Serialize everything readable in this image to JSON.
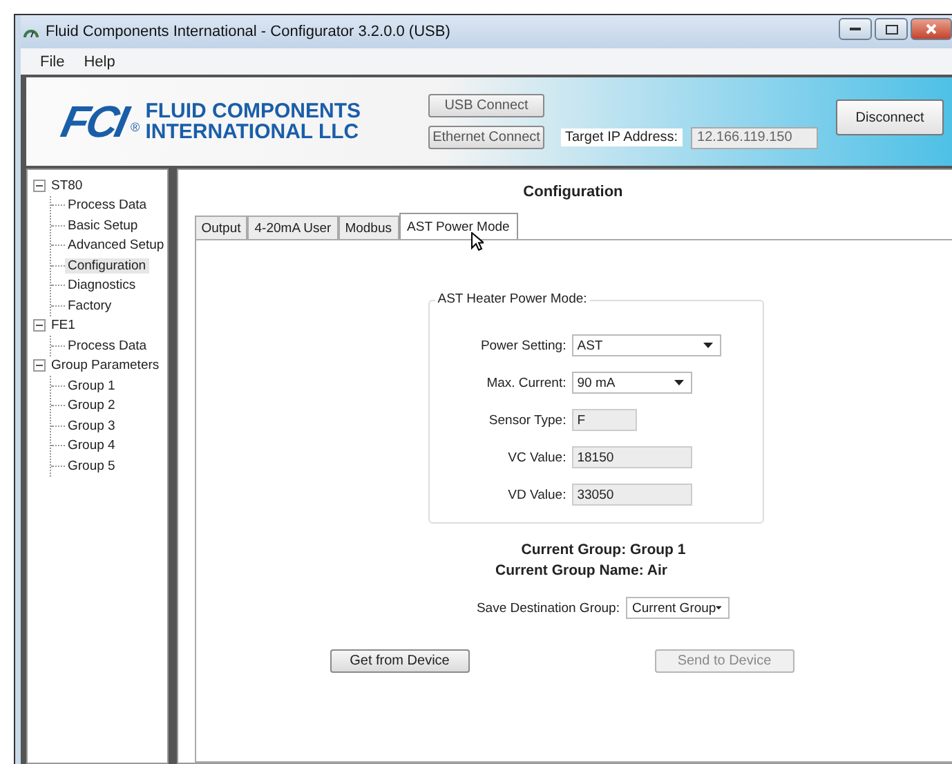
{
  "window": {
    "title": "Fluid Components International - Configurator 3.2.0.0 (USB)"
  },
  "menu": [
    "File",
    "Help"
  ],
  "header": {
    "logo_mark": "FCI",
    "logo_reg": "®",
    "company_line_1": "FLUID COMPONENTS",
    "company_line_2": "INTERNATIONAL LLC",
    "usb_button": "USB Connect",
    "ethernet_button": "Ethernet Connect",
    "ip_label": "Target IP Address:",
    "ip_value": "12.166.119.150",
    "disconnect_button": "Disconnect"
  },
  "tree": [
    {
      "label": "ST80",
      "expanded": true,
      "selected": false,
      "children": [
        {
          "label": "Process Data",
          "selected": false
        },
        {
          "label": "Basic Setup",
          "selected": false
        },
        {
          "label": "Advanced Setup",
          "selected": false
        },
        {
          "label": "Configuration",
          "selected": true
        },
        {
          "label": "Diagnostics",
          "selected": false
        },
        {
          "label": "Factory",
          "selected": false
        }
      ]
    },
    {
      "label": "FE1",
      "expanded": true,
      "selected": false,
      "children": [
        {
          "label": "Process Data",
          "selected": false
        }
      ]
    },
    {
      "label": "Group Parameters",
      "expanded": true,
      "selected": false,
      "children": [
        {
          "label": "Group 1",
          "selected": false
        },
        {
          "label": "Group 2",
          "selected": false
        },
        {
          "label": "Group 3",
          "selected": false
        },
        {
          "label": "Group 4",
          "selected": false
        },
        {
          "label": "Group 5",
          "selected": false
        }
      ]
    }
  ],
  "panel": {
    "title": "Configuration",
    "tabs": [
      {
        "label": "Output",
        "selected": false
      },
      {
        "label": "4-20mA User",
        "selected": false
      },
      {
        "label": "Modbus",
        "selected": false
      },
      {
        "label": "AST Power Mode",
        "selected": true
      }
    ],
    "group_title": "AST Heater Power Mode:",
    "fields": [
      {
        "kind": "dropdown",
        "label": "Power Setting:",
        "value": "AST"
      },
      {
        "kind": "dropdown",
        "label": "Max. Current:",
        "value": "90 mA"
      },
      {
        "kind": "readonly",
        "label": "Sensor Type:",
        "value": "F"
      },
      {
        "kind": "readonly",
        "label": "VC Value:",
        "value": "18150"
      },
      {
        "kind": "readonly",
        "label": "VD Value:",
        "value": "33050"
      }
    ],
    "current_group": "Current Group: Group 1",
    "current_group_name": "Current Group Name: Air",
    "save_label": "Save Destination Group:",
    "save_value": "Current Group",
    "buttons": [
      {
        "label": "Get from Device",
        "disabled": false
      },
      {
        "label": "Send to Device",
        "disabled": true
      }
    ]
  }
}
